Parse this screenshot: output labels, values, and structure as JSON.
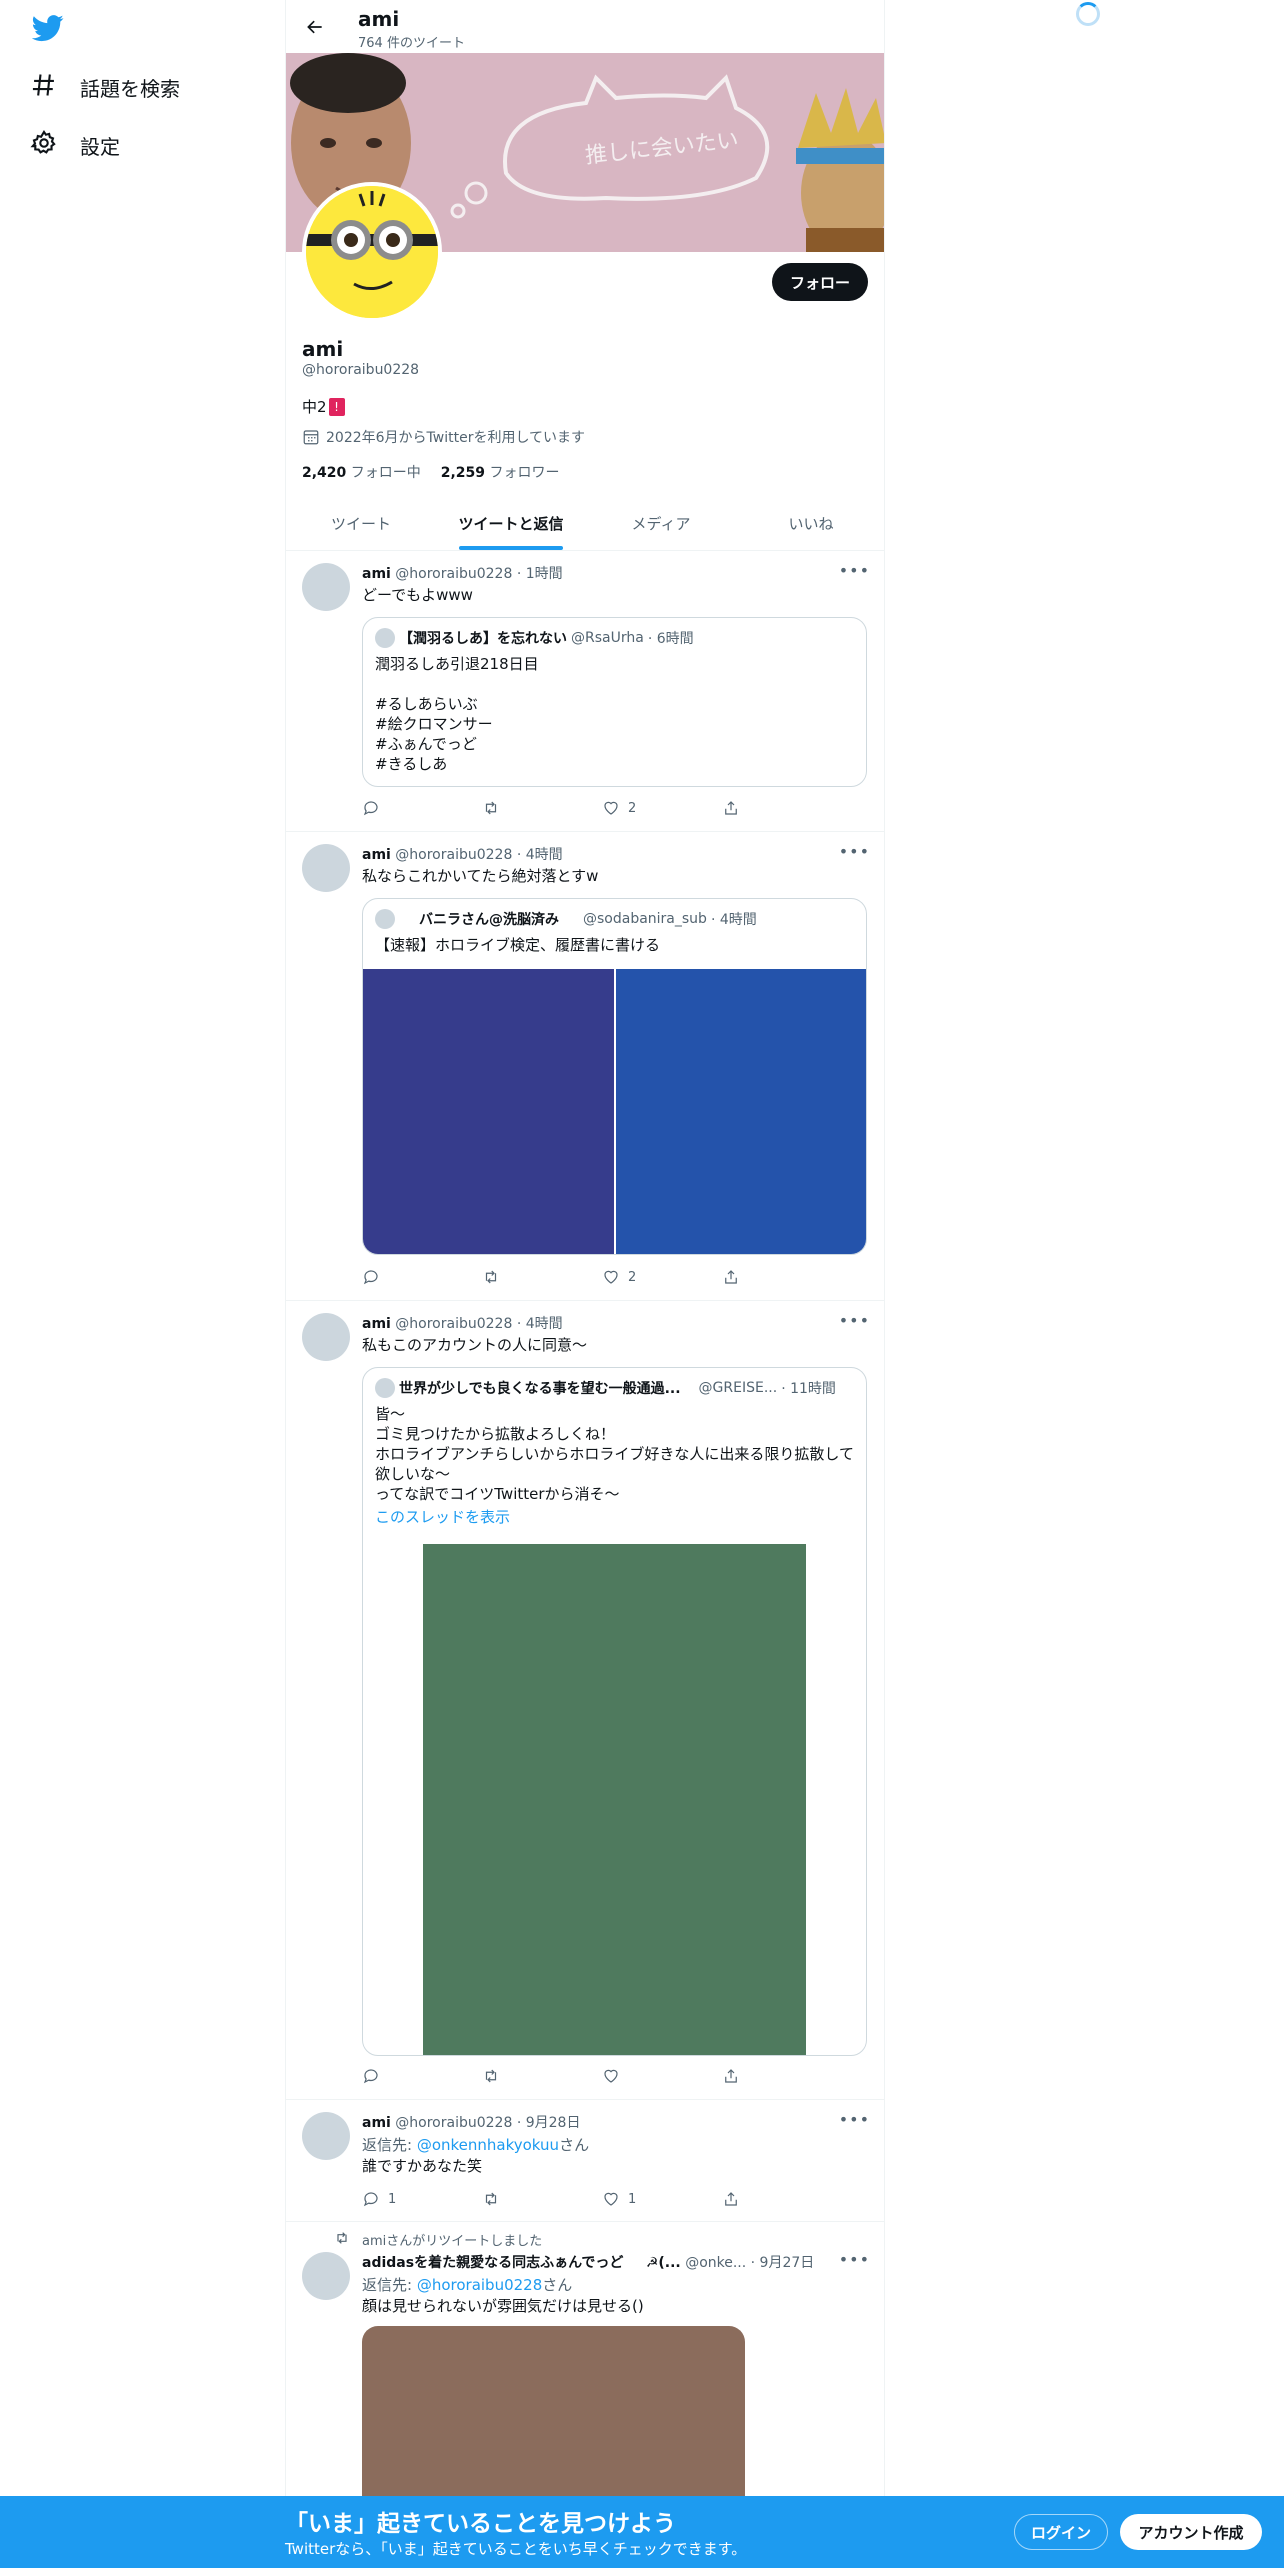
{
  "nav": {
    "explore_label": "話題を検索",
    "settings_label": "設定"
  },
  "header": {
    "title": "ami",
    "tweet_count": "764 件のツイート"
  },
  "profile": {
    "name": "ami",
    "handle": "@hororaibu0228",
    "bio": "中2",
    "bio_flag": "!",
    "joined": "2022年6月からTwitterを利用しています",
    "following_count": "2,420",
    "following_label": "フォロー中",
    "followers_count": "2,259",
    "followers_label": "フォロワー",
    "follow_button": "フォロー",
    "banner_text": "推しに会いたい"
  },
  "tabs": [
    "ツイート",
    "ツイートと返信",
    "メディア",
    "いいね"
  ],
  "tweets": [
    {
      "name": "ami",
      "handle": "@hororaibu0228",
      "time": "· 1時間",
      "text": "どーでもよwww",
      "quote": {
        "name": "【潤羽るしあ】を忘れない",
        "handle": "@RsaUrha",
        "time": "· 6時間",
        "text": "潤羽るしあ引退218日目\n\n#るしあらいぶ\n#絵クロマンサー\n#ふぁんでっど\n#きるしあ"
      },
      "likes": "2"
    },
    {
      "name": "ami",
      "handle": "@hororaibu0228",
      "time": "· 4時間",
      "text": "私ならこれかいてたら絶対落とすw",
      "quote": {
        "name": "バニラさん@洗脳済み",
        "handle": "@sodabanira_sub",
        "time": "· 4時間",
        "text": "【速報】ホロライブ検定、履歴書に書ける"
      },
      "likes": "2"
    },
    {
      "name": "ami",
      "handle": "@hororaibu0228",
      "time": "· 4時間",
      "text": "私もこのアカウントの人に同意〜",
      "quote": {
        "name": "世界が少しでも良くなる事を望む一般通過...",
        "handle": "@GREISE...",
        "time": "· 11時間",
        "text": "皆〜\nゴミ見つけたから拡散よろしくね！\nホロライブアンチらしいからホロライブ好きな人に出来る限り拡散して欲しいな〜\nってな訳でコイツTwitterから消そ〜",
        "thread_link": "このスレッドを表示"
      }
    },
    {
      "name": "ami",
      "handle": "@hororaibu0228",
      "time": "· 9月28日",
      "reply_prefix": "返信先: ",
      "reply_to": "@onkennhakyokuu",
      "reply_suffix": "さん",
      "text": "誰ですかあなた笑",
      "replies": "1",
      "likes": "1"
    },
    {
      "retweet_label": "amiさんがリツイートしました",
      "name": "adidasを着た親愛なる同志ふぁんでっど",
      "name_extra": "☭(...",
      "handle": "@onke...",
      "time": "· 9月27日",
      "reply_prefix": "返信先: ",
      "reply_to": "@hororaibu0228",
      "reply_suffix": "さん",
      "text": "顔は見せられないが雰囲気だけは見せる()"
    }
  ],
  "bottom_bar": {
    "title": "「いま」起きていることを見つけよう",
    "subtitle": "Twitterなら、「いま」起きていることをいち早くチェックできます。",
    "login": "ログイン",
    "signup": "アカウント作成"
  },
  "colors": {
    "accent": "#1d9bf0",
    "banner": "#d8b6c2",
    "image_left": "#363c8c",
    "image_right": "#2453ab",
    "image_green": "#4f7a5e",
    "image_brown": "#8b6c5c"
  }
}
